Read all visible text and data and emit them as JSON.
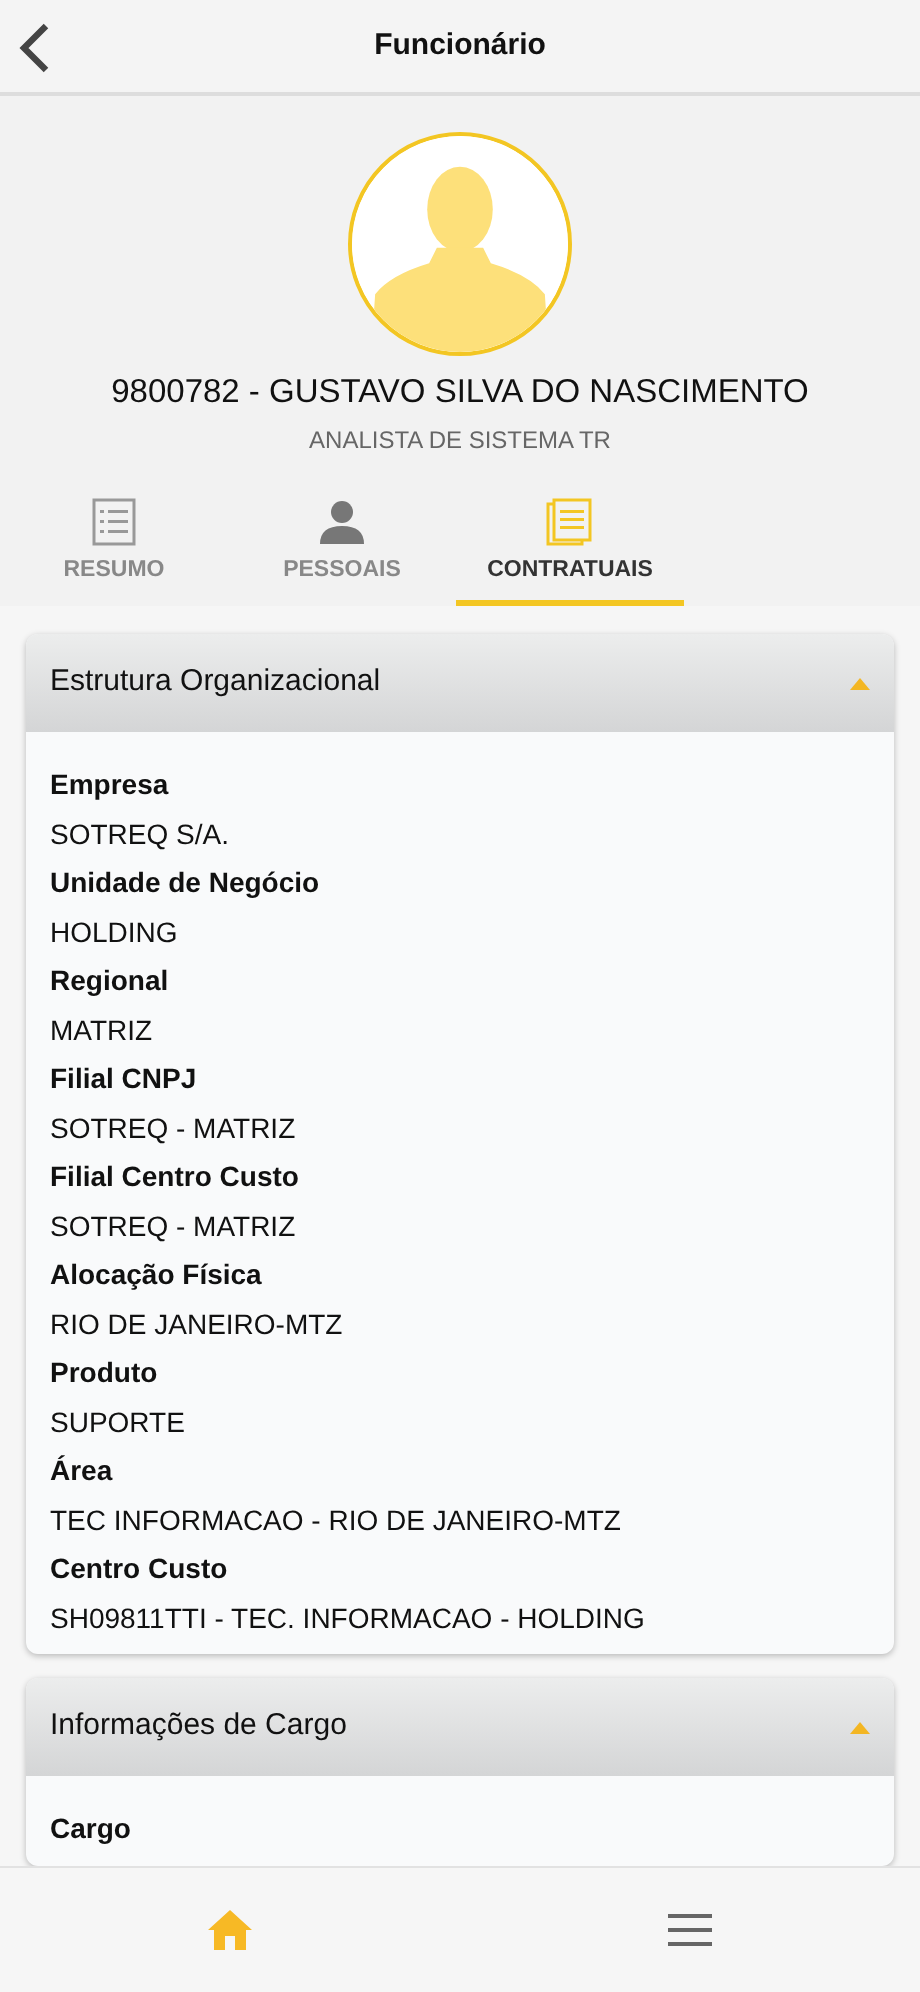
{
  "header": {
    "title": "Funcionário"
  },
  "profile": {
    "name": "9800782 - GUSTAVO SILVA DO NASCIMENTO",
    "role": "ANALISTA DE SISTEMA TR"
  },
  "tabs": [
    {
      "label": "RESUMO",
      "kind": "list",
      "selected": false
    },
    {
      "label": "PESSOAIS",
      "kind": "person",
      "selected": false
    },
    {
      "label": "CONTRATUAIS",
      "kind": "document",
      "selected": true
    }
  ],
  "sections": [
    {
      "title": "Estrutura Organizacional",
      "expanded": true,
      "fields": [
        {
          "label": "Empresa",
          "value": "SOTREQ S/A."
        },
        {
          "label": "Unidade de Negócio",
          "value": "HOLDING"
        },
        {
          "label": "Regional",
          "value": "MATRIZ"
        },
        {
          "label": "Filial CNPJ",
          "value": "SOTREQ - MATRIZ"
        },
        {
          "label": "Filial Centro Custo",
          "value": "SOTREQ - MATRIZ"
        },
        {
          "label": "Alocação Física",
          "value": "RIO DE JANEIRO-MTZ"
        },
        {
          "label": "Produto",
          "value": "SUPORTE"
        },
        {
          "label": "Área",
          "value": "TEC INFORMACAO - RIO DE JANEIRO-MTZ"
        },
        {
          "label": "Centro Custo",
          "value": "SH09811TTI - TEC. INFORMACAO - HOLDING"
        }
      ]
    },
    {
      "title": "Informações de Cargo",
      "expanded": true,
      "fields": [
        {
          "label": "Cargo"
        }
      ]
    }
  ],
  "bottom_nav": [
    {
      "kind": "home",
      "selected": true
    },
    {
      "kind": "menu",
      "selected": false
    }
  ]
}
